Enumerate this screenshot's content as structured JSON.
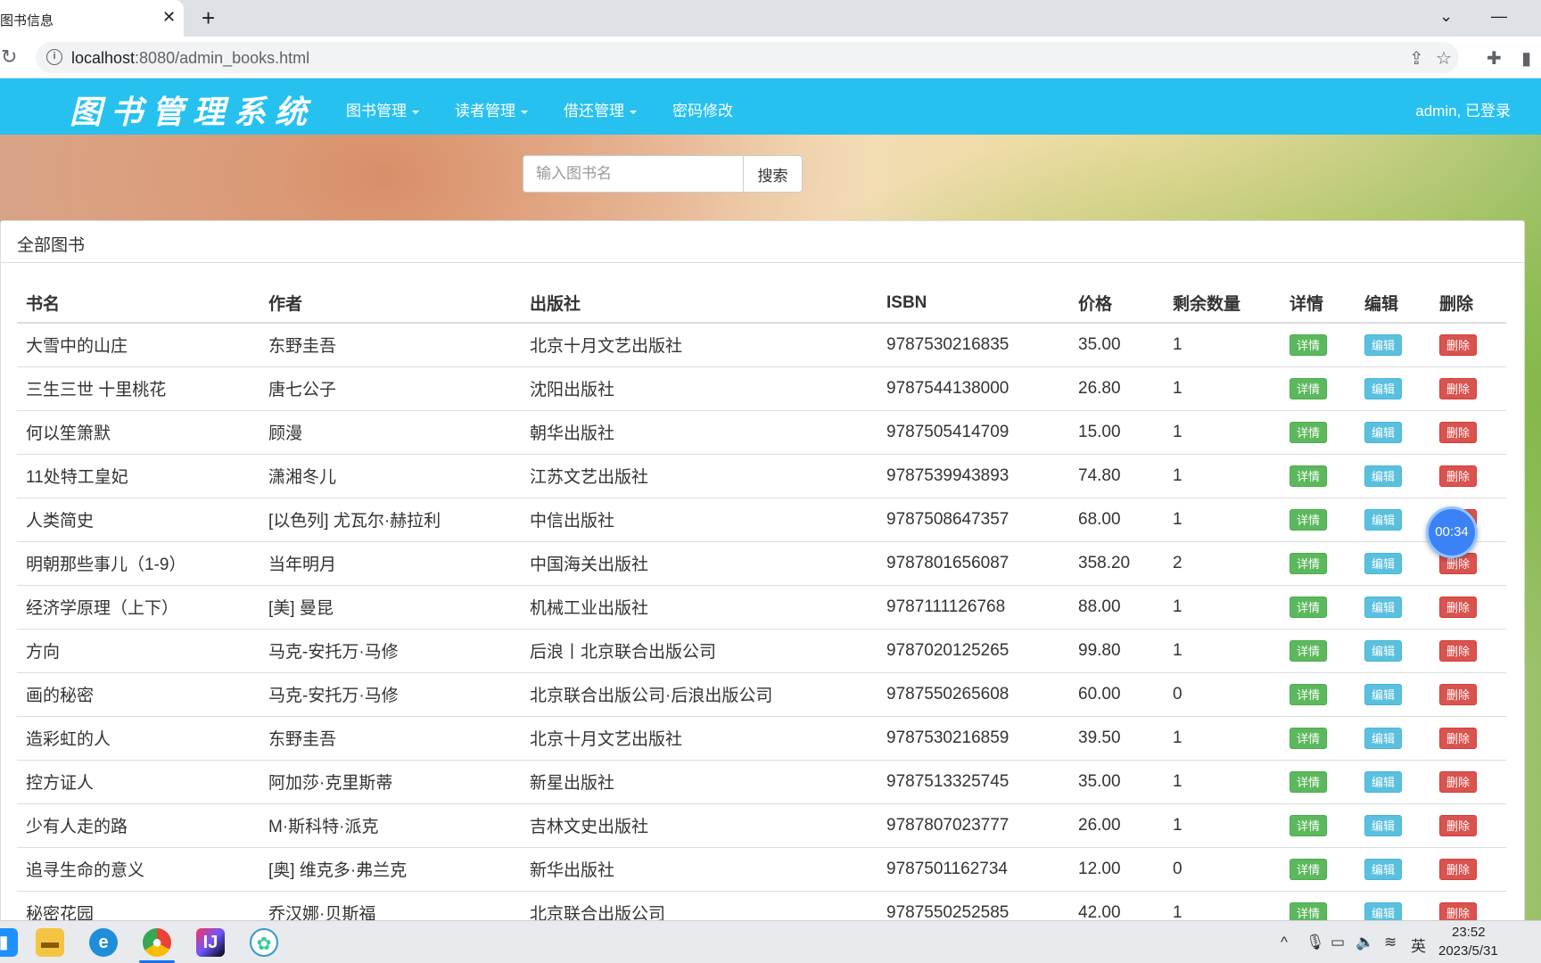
{
  "browser": {
    "tab_title": "图书信息",
    "close_glyph": "✕",
    "newtab_glyph": "+",
    "url_host": "localhost",
    "url_path": ":8080/admin_books.html",
    "icons": [
      "reload-icon",
      "info-icon",
      "share-icon",
      "star-icon",
      "extensions-icon",
      "sidepanel-icon"
    ]
  },
  "navbar": {
    "brand": "图书管理系统",
    "menus": [
      {
        "label": "图书管理",
        "dropdown": true
      },
      {
        "label": "读者管理",
        "dropdown": true
      },
      {
        "label": "借还管理",
        "dropdown": true
      },
      {
        "label": "密码修改",
        "dropdown": false
      }
    ],
    "user_status": "admin, 已登录",
    "color": "#27c1f0"
  },
  "search": {
    "placeholder": "输入图书名",
    "button_label": "搜索"
  },
  "panel": {
    "title": "全部图书"
  },
  "table": {
    "headers": [
      "书名",
      "作者",
      "出版社",
      "ISBN",
      "价格",
      "剩余数量",
      "详情",
      "编辑",
      "删除"
    ],
    "action_labels": {
      "detail": "详情",
      "edit": "编辑",
      "delete": "删除"
    },
    "rows": [
      {
        "name": "大雪中的山庄",
        "author": "东野圭吾",
        "publisher": "北京十月文艺出版社",
        "isbn": "9787530216835",
        "price": "35.00",
        "qty": "1"
      },
      {
        "name": "三生三世 十里桃花",
        "author": "唐七公子",
        "publisher": "沈阳出版社",
        "isbn": "9787544138000",
        "price": "26.80",
        "qty": "1"
      },
      {
        "name": "何以笙箫默",
        "author": "顾漫",
        "publisher": "朝华出版社",
        "isbn": "9787505414709",
        "price": "15.00",
        "qty": "1"
      },
      {
        "name": "11处特工皇妃",
        "author": "潇湘冬儿",
        "publisher": "江苏文艺出版社",
        "isbn": "9787539943893",
        "price": "74.80",
        "qty": "1"
      },
      {
        "name": "人类简史",
        "author": "[以色列] 尤瓦尔·赫拉利",
        "publisher": "中信出版社",
        "isbn": "9787508647357",
        "price": "68.00",
        "qty": "1"
      },
      {
        "name": "明朝那些事儿（1-9）",
        "author": "当年明月",
        "publisher": "中国海关出版社",
        "isbn": "9787801656087",
        "price": "358.20",
        "qty": "2"
      },
      {
        "name": "经济学原理（上下）",
        "author": "[美] 曼昆",
        "publisher": "机械工业出版社",
        "isbn": "9787111126768",
        "price": "88.00",
        "qty": "1"
      },
      {
        "name": "方向",
        "author": "马克-安托万·马修",
        "publisher": "后浪丨北京联合出版公司",
        "isbn": "9787020125265",
        "price": "99.80",
        "qty": "1"
      },
      {
        "name": "画的秘密",
        "author": "马克-安托万·马修",
        "publisher": "北京联合出版公司·后浪出版公司",
        "isbn": "9787550265608",
        "price": "60.00",
        "qty": "0"
      },
      {
        "name": "造彩虹的人",
        "author": "东野圭吾",
        "publisher": "北京十月文艺出版社",
        "isbn": "9787530216859",
        "price": "39.50",
        "qty": "1"
      },
      {
        "name": "控方证人",
        "author": "阿加莎·克里斯蒂",
        "publisher": "新星出版社",
        "isbn": "9787513325745",
        "price": "35.00",
        "qty": "1"
      },
      {
        "name": "少有人走的路",
        "author": "M·斯科特·派克",
        "publisher": "吉林文史出版社",
        "isbn": "9787807023777",
        "price": "26.00",
        "qty": "1"
      },
      {
        "name": "追寻生命的意义",
        "author": "[奥] 维克多·弗兰克",
        "publisher": "新华出版社",
        "isbn": "9787501162734",
        "price": "12.00",
        "qty": "0"
      },
      {
        "name": "秘密花园",
        "author": "乔汉娜·贝斯福",
        "publisher": "北京联合出版公司",
        "isbn": "9787550252585",
        "price": "42.00",
        "qty": "1"
      }
    ]
  },
  "timer": "00:34",
  "taskbar": {
    "apps": [
      "file-explorer-icon",
      "edge-icon",
      "chrome-icon",
      "intellij-icon",
      "app-icon"
    ],
    "tray_lang": "英",
    "time": "23:52",
    "date": "2023/5/31"
  }
}
